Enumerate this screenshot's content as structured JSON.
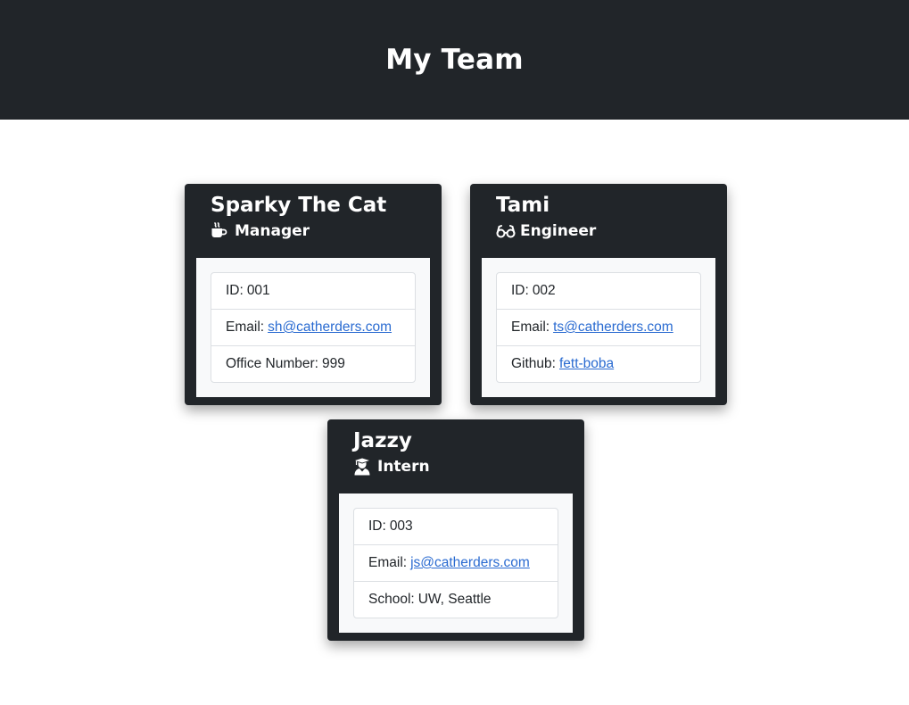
{
  "header": {
    "title": "My Team"
  },
  "employees": [
    {
      "name": "Sparky The Cat",
      "role": "Manager",
      "role_icon": "mug-hot-icon",
      "id_label": "ID:",
      "id": "001",
      "email_label": "Email:",
      "email": "sh@catherders.com",
      "extra_label": "Office Number:",
      "extra_value": "999"
    },
    {
      "name": "Tami",
      "role": "Engineer",
      "role_icon": "glasses-icon",
      "id_label": "ID:",
      "id": "002",
      "email_label": "Email:",
      "email": "ts@catherders.com",
      "extra_label": "Github:",
      "extra_value": "fett-boba"
    },
    {
      "name": "Jazzy",
      "role": "Intern",
      "role_icon": "user-graduate-icon",
      "id_label": "ID:",
      "id": "003",
      "email_label": "Email:",
      "email": "js@catherders.com",
      "extra_label": "School:",
      "extra_value": "UW, Seattle"
    }
  ],
  "colors": {
    "header_bg": "#212529",
    "card_bg": "#212529",
    "card_body_bg": "#f8f9fa",
    "link": "#2a6bd1"
  }
}
